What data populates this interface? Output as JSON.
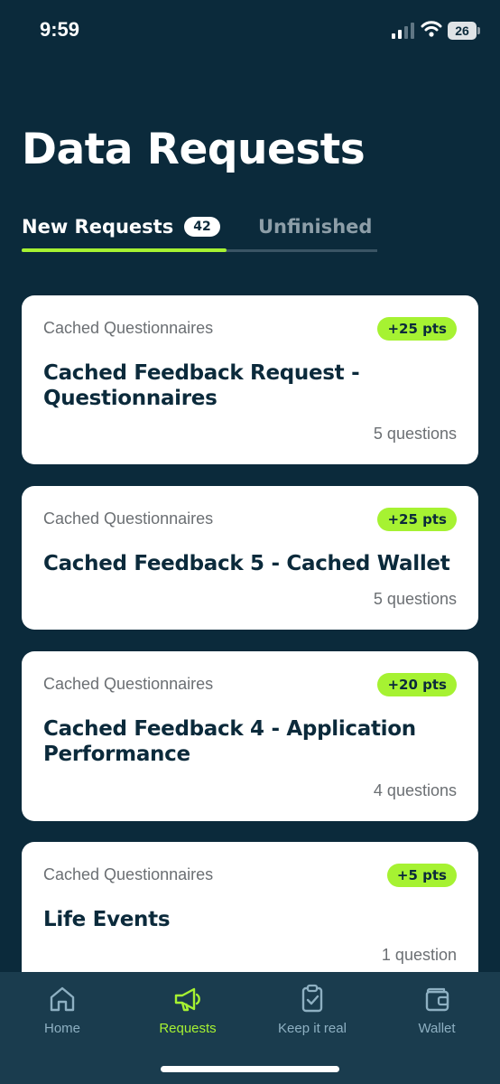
{
  "status_bar": {
    "time": "9:59",
    "battery": "26"
  },
  "page": {
    "title": "Data Requests"
  },
  "tabs": {
    "new_label": "New Requests",
    "new_count": "42",
    "unfinished_label": "Unfinished"
  },
  "cards": [
    {
      "category": "Cached Questionnaires",
      "points": "+25 pts",
      "title": "Cached Feedback Request - Questionnaires",
      "questions": "5 questions"
    },
    {
      "category": "Cached Questionnaires",
      "points": "+25 pts",
      "title": "Cached Feedback 5 - Cached Wallet",
      "questions": "5 questions"
    },
    {
      "category": "Cached Questionnaires",
      "points": "+20 pts",
      "title": "Cached Feedback 4 - Application Performance",
      "questions": "4 questions"
    },
    {
      "category": "Cached Questionnaires",
      "points": "+5 pts",
      "title": "Life Events",
      "questions": "1 question"
    }
  ],
  "nav": {
    "items": [
      {
        "label": "Home",
        "icon": "home-icon"
      },
      {
        "label": "Requests",
        "icon": "megaphone-icon"
      },
      {
        "label": "Keep it real",
        "icon": "clipboard-check-icon"
      },
      {
        "label": "Wallet",
        "icon": "wallet-icon"
      }
    ],
    "active": "Requests"
  },
  "colors": {
    "background": "#0b2a3b",
    "accent": "#a6f232",
    "nav_background": "#1a3c4e",
    "card": "#ffffff"
  }
}
